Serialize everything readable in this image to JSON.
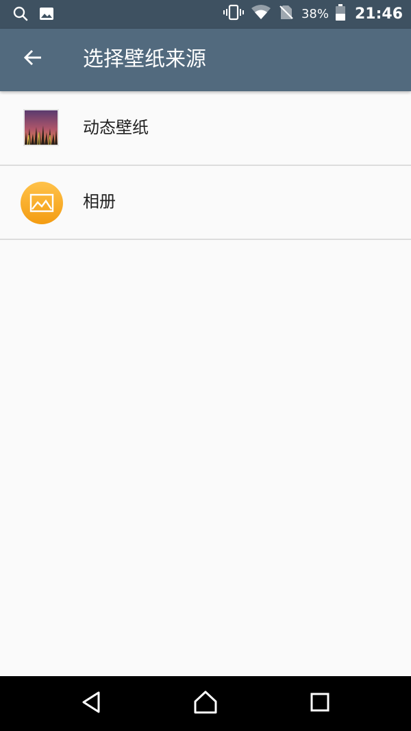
{
  "status_bar": {
    "icons_left": [
      "search-icon",
      "image-icon"
    ],
    "icons_right": [
      "vibrate-icon",
      "wifi-icon",
      "no-sim-icon",
      "battery-icon"
    ],
    "battery_percent": "38%",
    "time": "21:46"
  },
  "app_bar": {
    "title": "选择壁纸来源",
    "back_icon": "arrow-back-icon"
  },
  "list": {
    "items": [
      {
        "label": "动态壁纸",
        "icon": "live-wallpaper-icon"
      },
      {
        "label": "相册",
        "icon": "gallery-icon"
      }
    ]
  },
  "nav_bar": {
    "buttons": [
      "back-nav-icon",
      "home-nav-icon",
      "recents-nav-icon"
    ]
  },
  "colors": {
    "status_bar": "#3e5161",
    "app_bar": "#526a7e",
    "background": "#fafafa",
    "divider": "#dcdcdc",
    "gallery_accent": "#f5a623",
    "nav_bar": "#000000"
  }
}
